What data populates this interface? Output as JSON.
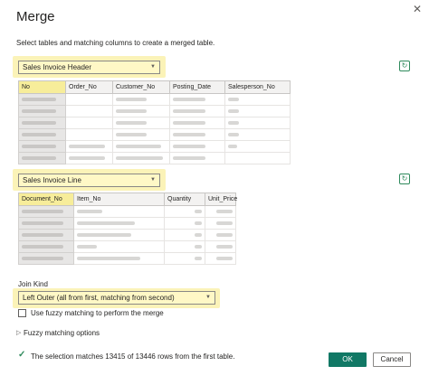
{
  "dialog": {
    "title": "Merge",
    "close_icon": "close-icon",
    "subtitle": "Select tables and matching columns to create a merged table."
  },
  "first_table": {
    "selected": "Sales Invoice Header",
    "columns": [
      "No",
      "Order_No",
      "Customer_No",
      "Posting_Date",
      "Salesperson_No"
    ],
    "selected_column": "No"
  },
  "second_table": {
    "selected": "Sales Invoice Line",
    "columns": [
      "Document_No",
      "Item_No",
      "Quantity",
      "Unit_Price"
    ],
    "selected_column": "Document_No"
  },
  "join": {
    "label": "Join Kind",
    "selected": "Left Outer (all from first, matching from second)"
  },
  "fuzzy": {
    "checkbox_label": "Use fuzzy matching to perform the merge",
    "options_label": "Fuzzy matching options",
    "checked": false
  },
  "status": {
    "text": "The selection matches 13415 of 13446 rows from the first table."
  },
  "buttons": {
    "ok": "OK",
    "cancel": "Cancel"
  },
  "colors": {
    "accent": "#117865",
    "highlight": "#fbf3b8",
    "success": "#2f8a5c"
  }
}
